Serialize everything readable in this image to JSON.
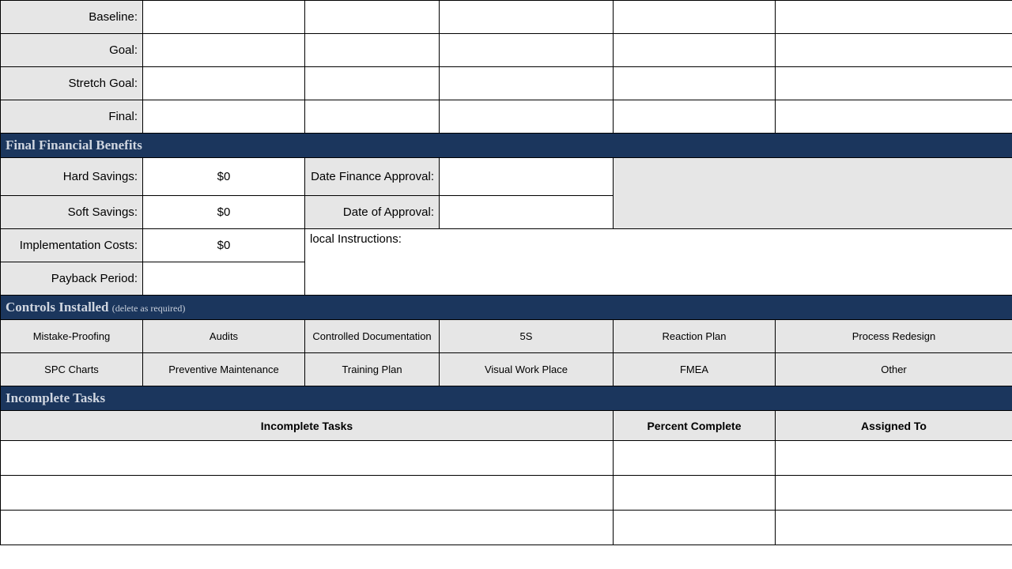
{
  "metrics": {
    "rows": [
      {
        "label": "Baseline:"
      },
      {
        "label": "Goal:"
      },
      {
        "label": "Stretch Goal:"
      },
      {
        "label": "Final:"
      }
    ]
  },
  "financial": {
    "header": "Final Financial Benefits",
    "hard_savings_label": "Hard Savings:",
    "hard_savings_value": "$0",
    "date_finance_label": "Date Finance Approval:",
    "soft_savings_label": "Soft Savings:",
    "soft_savings_value": "$0",
    "date_approval_label": "Date of Approval:",
    "impl_costs_label": "Implementation Costs:",
    "impl_costs_value": "$0",
    "instructions_label": "local Instructions:",
    "payback_label": "Payback Period:"
  },
  "controls": {
    "header_main": "Controls Installed",
    "header_sub": "(delete as required)",
    "row1": [
      "Mistake-Proofing",
      "Audits",
      "Controlled Documentation",
      "5S",
      "Reaction Plan",
      "Process Redesign"
    ],
    "row2": [
      "SPC Charts",
      "Preventive Maintenance",
      "Training Plan",
      "Visual Work Place",
      "FMEA",
      "Other"
    ]
  },
  "incomplete": {
    "header": "Incomplete Tasks",
    "col_tasks": "Incomplete Tasks",
    "col_percent": "Percent Complete",
    "col_assigned": "Assigned To"
  }
}
